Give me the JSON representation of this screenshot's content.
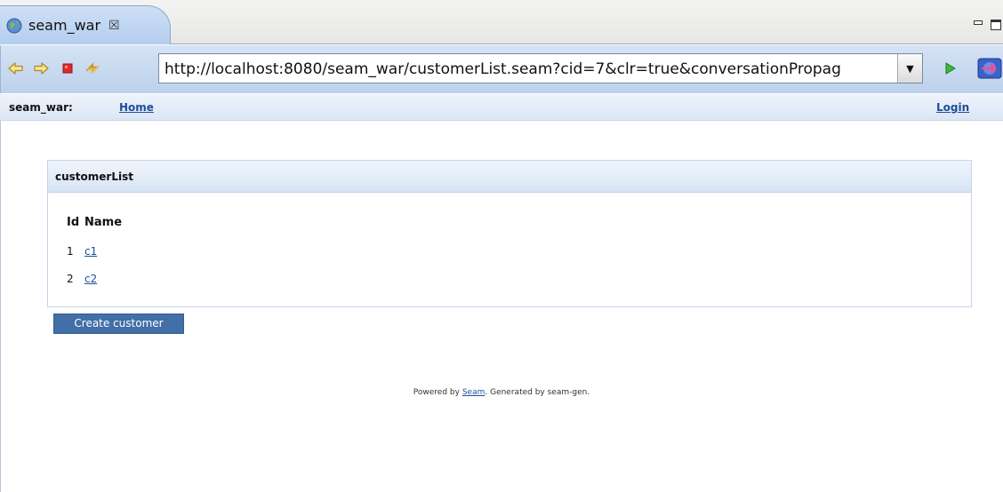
{
  "editor_tab": {
    "title": "seam_war",
    "close_glyph": "☒",
    "icon": "globe-icon"
  },
  "toolbar": {
    "back_icon": "back-arrow-icon",
    "forward_icon": "forward-arrow-icon",
    "stop_icon": "stop-icon",
    "refresh_icon": "refresh-icon",
    "url": "http://localhost:8080/seam_war/customerList.seam?cid=7&clr=true&conversationPropag",
    "dropdown_glyph": "▼",
    "go_icon": "go-arrow-icon",
    "web_icon": "web-browser-icon"
  },
  "app_header": {
    "app_name": "seam_war:",
    "home_link": "Home",
    "login_link": "Login"
  },
  "panel": {
    "title": "customerList",
    "columns": [
      "Id",
      "Name"
    ],
    "rows": [
      {
        "id": "1",
        "name": "c1"
      },
      {
        "id": "2",
        "name": "c2"
      }
    ]
  },
  "create_button": "Create customer",
  "footer": {
    "prefix": "Powered by ",
    "link": "Seam",
    "suffix": ". Generated by seam-gen."
  },
  "colors": {
    "accent_link": "#1d4e9a",
    "button_bg": "#426fa6",
    "tab_bg": "#b3cdee"
  }
}
